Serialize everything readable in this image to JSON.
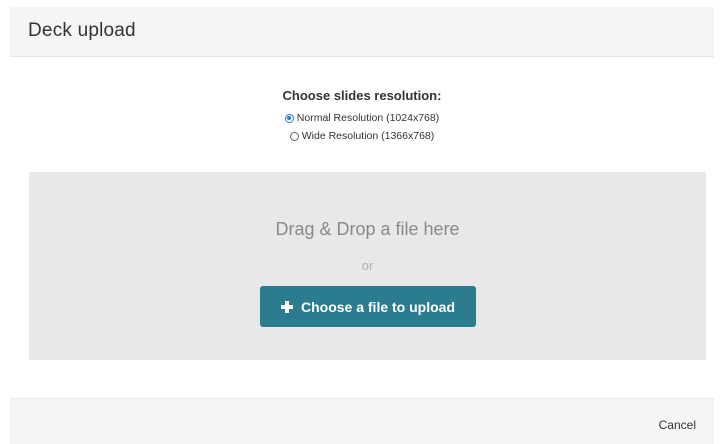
{
  "header": {
    "title": "Deck upload"
  },
  "resolution": {
    "title": "Choose slides resolution:",
    "options": [
      {
        "label": "Normal Resolution (1024x768)",
        "selected": true
      },
      {
        "label": "Wide Resolution (1366x768)",
        "selected": false
      }
    ]
  },
  "dropzone": {
    "drag_text": "Drag & Drop a file here",
    "or_text": "or",
    "upload_button_label": "Choose a file to upload",
    "upload_button_icon": "plus-icon"
  },
  "footer": {
    "cancel_label": "Cancel"
  },
  "colors": {
    "accent": "#2b7c8f",
    "radio_selected": "#2a7bd6",
    "dropzone_bg": "#e8e8e8"
  }
}
